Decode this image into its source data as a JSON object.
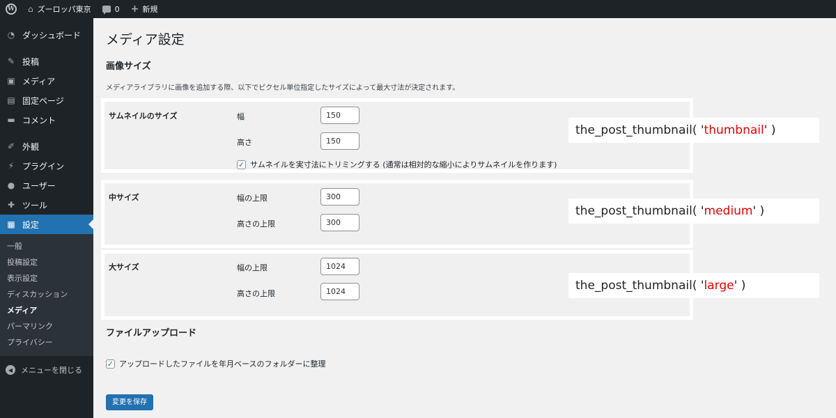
{
  "adminbar": {
    "site_name": "ズーロッパ東京",
    "comments_count": "0",
    "new_label": "新規"
  },
  "sidebar": {
    "menu": [
      {
        "label": "ダッシュボード",
        "icon": "dashboard-icon"
      },
      {
        "label": "投稿",
        "icon": "pin-icon"
      },
      {
        "label": "メディア",
        "icon": "media-icon"
      },
      {
        "label": "固定ページ",
        "icon": "page-icon"
      },
      {
        "label": "コメント",
        "icon": "comment-icon"
      },
      {
        "label": "外観",
        "icon": "brush-icon"
      },
      {
        "label": "プラグイン",
        "icon": "plugin-icon"
      },
      {
        "label": "ユーザー",
        "icon": "user-icon"
      },
      {
        "label": "ツール",
        "icon": "wrench-icon"
      },
      {
        "label": "設定",
        "icon": "settings-icon"
      }
    ],
    "submenu": [
      "一般",
      "投稿設定",
      "表示設定",
      "ディスカッション",
      "メディア",
      "パーマリンク",
      "プライバシー"
    ],
    "collapse_label": "メニューを閉じる"
  },
  "main": {
    "page_title": "メディア設定",
    "image_sizes_heading": "画像サイズ",
    "description": "メディアライブラリに画像を追加する際、以下でピクセル単位指定したサイズによって最大寸法が決定されます。",
    "thumbnail": {
      "label": "サムネイルのサイズ",
      "width_label": "幅",
      "width_value": "150",
      "height_label": "高さ",
      "height_value": "150",
      "crop_label": "サムネイルを実寸法にトリミングする (通常は相対的な縮小によりサムネイルを作ります)",
      "crop_checked": true
    },
    "medium": {
      "label": "中サイズ",
      "width_label": "幅の上限",
      "width_value": "300",
      "height_label": "高さの上限",
      "height_value": "300"
    },
    "large": {
      "label": "大サイズ",
      "width_label": "幅の上限",
      "width_value": "1024",
      "height_label": "高さの上限",
      "height_value": "1024"
    },
    "uploads_heading": "ファイルアップロード",
    "uploads_checkbox_label": "アップロードしたファイルを年月ベースのフォルダーに整理",
    "uploads_checked": true,
    "save_label": "変更を保存"
  },
  "callouts": {
    "thumbnail": {
      "prefix": "the_post_thumbnail( '",
      "arg": "thumbnail",
      "suffix": "' )"
    },
    "medium": {
      "prefix": "the_post_thumbnail( '",
      "arg": "medium",
      "suffix": "' )"
    },
    "large": {
      "prefix": "the_post_thumbnail( '",
      "arg": "large",
      "suffix": "' )"
    }
  },
  "colors": {
    "accent": "#2271b1",
    "admin_dark": "#1d2327",
    "callout_arg": "#e00000"
  }
}
